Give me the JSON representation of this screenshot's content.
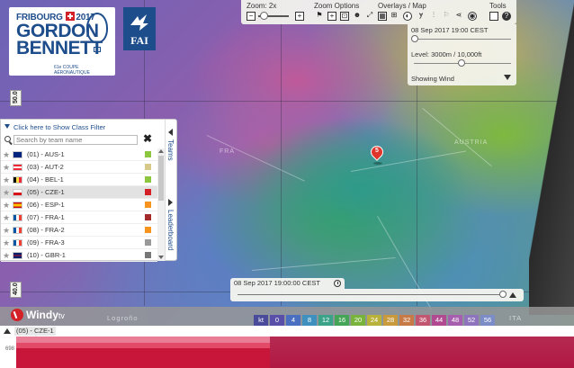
{
  "logos": {
    "fb_top_left": "FRIBOURG",
    "fb_top_right": "2017",
    "fb_main_line1": "GORDON",
    "fb_main_line2": "BENNETT",
    "fb_sub": "61e COUPE AÉRONAUTIQUE",
    "fai_text": "FAI"
  },
  "toolbar": {
    "zoom_label": "Zoom: 2x",
    "zoom_options_label": "Zoom Options",
    "overlays_label": "Overlays / Map",
    "tools_label": "Tools",
    "zoom_out": "−",
    "zoom_in": "+",
    "zoom_level_fraction": 0.05
  },
  "time_panel": {
    "date": "08 Sep 2017 19:00 CEST",
    "level": "Level: 3000m / 10,000ft",
    "overlay": "Showing Wind",
    "time_fraction": 0.0,
    "level_fraction": 0.5
  },
  "latitudes": [
    "50.0",
    "40.0"
  ],
  "team_panel": {
    "filter_text": "Click here to Show Class Filter",
    "search_placeholder": "Search by team name",
    "clear": "✖",
    "tab_teams": "Teams",
    "tab_leaderboard": "Leaderboard",
    "teams": [
      {
        "label": "(01) - AUS-1",
        "flag": "aus",
        "color": "#8dc63f",
        "selected": false
      },
      {
        "label": "(03) - AUT-2",
        "flag": "aut",
        "color": "#d6c98a",
        "selected": false
      },
      {
        "label": "(04) - BEL-1",
        "flag": "bel",
        "color": "#8dc63f",
        "selected": false
      },
      {
        "label": "(05) - CZE-1",
        "flag": "cze",
        "color": "#d42027",
        "selected": true
      },
      {
        "label": "(06) - ESP-1",
        "flag": "esp",
        "color": "#f7941d",
        "selected": false
      },
      {
        "label": "(07) - FRA-1",
        "flag": "fra",
        "color": "#a52a2a",
        "selected": false
      },
      {
        "label": "(08) - FRA-2",
        "flag": "fra",
        "color": "#f7941d",
        "selected": false
      },
      {
        "label": "(09) - FRA-3",
        "flag": "fra",
        "color": "#999999",
        "selected": false
      },
      {
        "label": "(10) - GBR-1",
        "flag": "gbr",
        "color": "#777777",
        "selected": false
      }
    ]
  },
  "map_places": [
    "FRA",
    "AUSTRIA",
    "Logroño",
    "ITA"
  ],
  "marker_number": "5",
  "timebar": {
    "date": "08 Sep 2017 19:00:00 CEST",
    "position_fraction": 0.99
  },
  "windy": {
    "name": "Windy",
    "suffix": "tv"
  },
  "legend": {
    "unit": "kt",
    "values": [
      "0",
      "4",
      "8",
      "12",
      "16",
      "20",
      "24",
      "28",
      "32",
      "36",
      "44",
      "48",
      "52",
      "56"
    ],
    "colors": [
      "#5a4fa8",
      "#4b6fc0",
      "#3f8fbf",
      "#3aa38a",
      "#44a557",
      "#78b43c",
      "#b9b23a",
      "#c99a3c",
      "#c77a45",
      "#c25570",
      "#b24a91",
      "#a65fae",
      "#8d74bc",
      "#7b8cc7"
    ]
  },
  "timeline": {
    "label": "(05) - CZE-1",
    "tick": "698"
  }
}
